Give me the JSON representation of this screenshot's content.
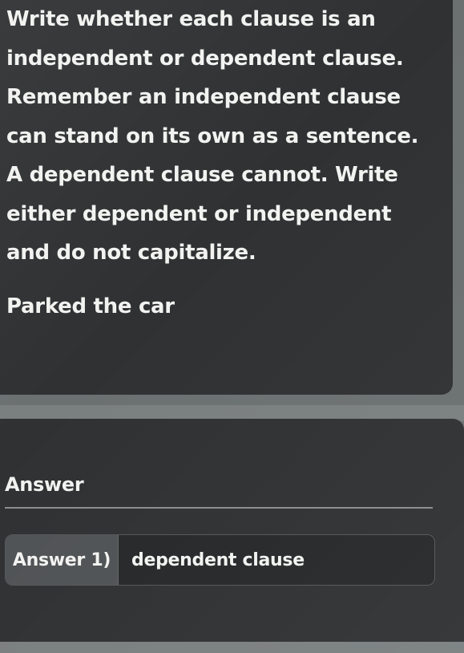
{
  "question": {
    "lines": [
      "Write whether each clause is an",
      "independent or dependent clause.",
      "Remember an independent clause",
      "can stand on its own as a sentence.",
      "A dependent clause cannot. Write",
      "either dependent or independent",
      "and do not capitalize."
    ],
    "prompt": "Parked the car"
  },
  "answer": {
    "heading": "Answer",
    "items": [
      {
        "label": "Answer 1)",
        "value": "dependent clause"
      }
    ]
  }
}
